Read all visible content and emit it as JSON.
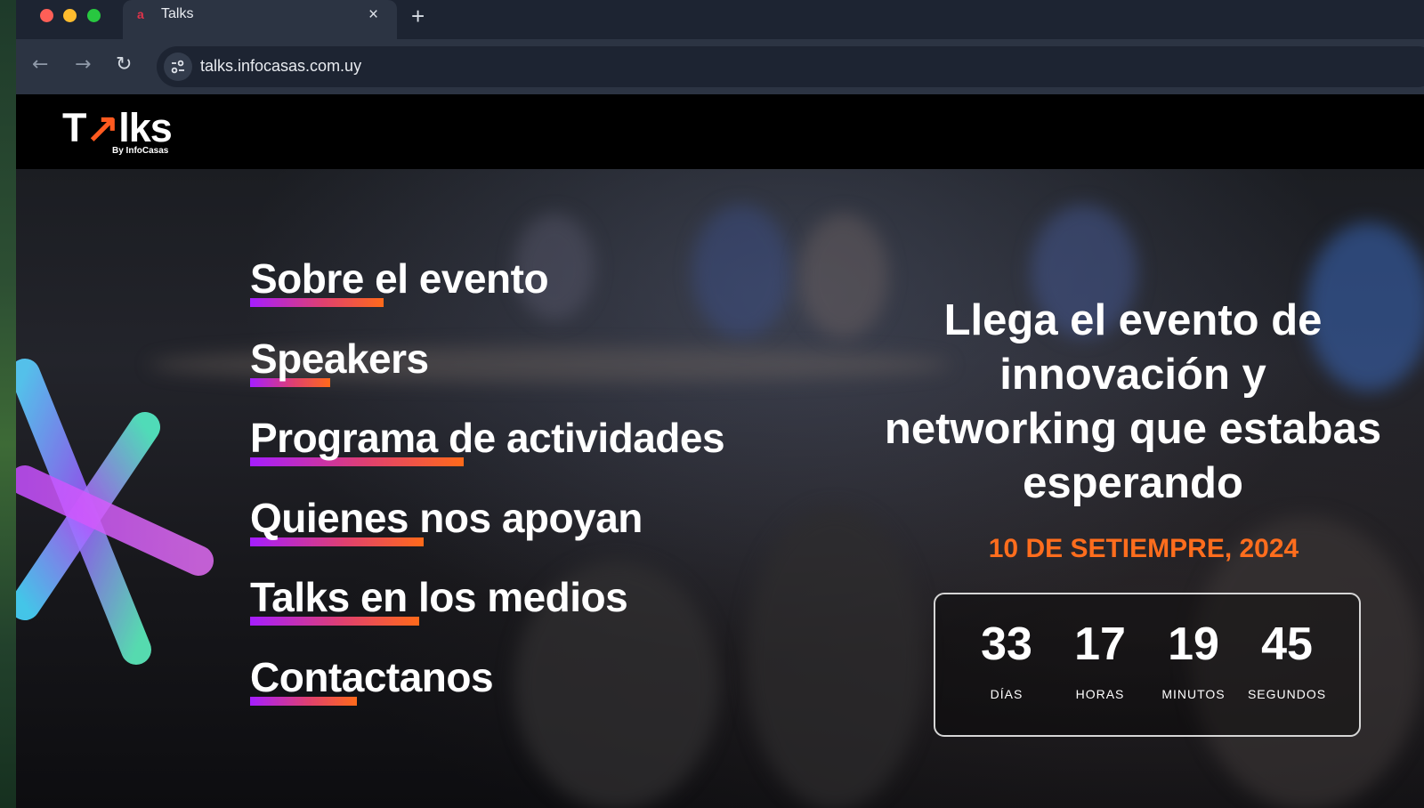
{
  "browser": {
    "tab_title": "Talks",
    "tab_favicon": "a",
    "url": "talks.infocasas.com.uy",
    "close_icon": "×",
    "new_tab_icon": "+",
    "back_icon": "←",
    "forward_icon": "→",
    "reload_icon": "↻"
  },
  "header": {
    "logo_t": "T",
    "logo_arrow": "↗",
    "logo_rest": "lks",
    "logo_sub": "By InfoCasas",
    "accent_color": "#ff5a1f"
  },
  "menu": [
    {
      "label": "Sobre el evento"
    },
    {
      "label": "Speakers"
    },
    {
      "label": "Programa de actividades"
    },
    {
      "label": "Quienes nos apoyan"
    },
    {
      "label": "Talks en los medios"
    },
    {
      "label": "Contactanos"
    }
  ],
  "hero": {
    "line1": "Llega el evento de",
    "line2": "innovación y",
    "line3": "networking que estabas",
    "line4": "esperando",
    "date": "10 DE SETIEMPRE, 2024",
    "date_color": "#ff6d1d"
  },
  "countdown": {
    "days": {
      "value": "33",
      "label": "DÍAS"
    },
    "hours": {
      "value": "17",
      "label": "HORAS"
    },
    "minutes": {
      "value": "19",
      "label": "MINUTOS"
    },
    "seconds": {
      "value": "45",
      "label": "SEGUNDOS"
    }
  }
}
